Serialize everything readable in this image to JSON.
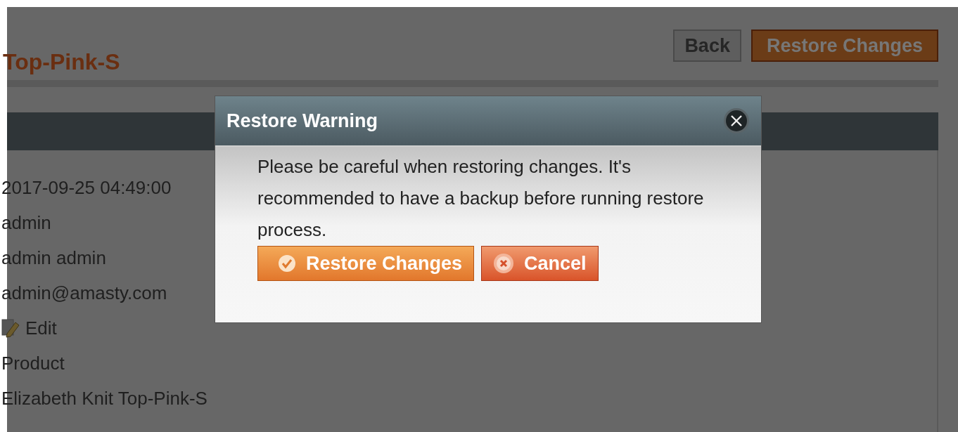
{
  "page": {
    "title": "Top-Pink-S",
    "buttons": [
      {
        "label": "Back",
        "kind": "plain"
      },
      {
        "label": "Restore Changes",
        "kind": "primary"
      }
    ],
    "details": [
      {
        "kind": "text",
        "text": "2017-09-25 04:49:00"
      },
      {
        "kind": "text",
        "text": "admin"
      },
      {
        "kind": "text",
        "text": "admin admin"
      },
      {
        "kind": "text",
        "text": "admin@amasty.com"
      },
      {
        "kind": "link",
        "text": "Edit"
      },
      {
        "kind": "text",
        "text": "Product"
      },
      {
        "kind": "text",
        "text": "Elizabeth Knit Top-Pink-S"
      }
    ]
  },
  "dialog": {
    "title": "Restore Warning",
    "message": "Please be careful when restoring changes. It's recommended to have a backup before running restore process.",
    "buttons": [
      {
        "label": "Restore Changes",
        "kind": "confirm"
      },
      {
        "label": "Cancel",
        "kind": "cancel"
      }
    ]
  }
}
